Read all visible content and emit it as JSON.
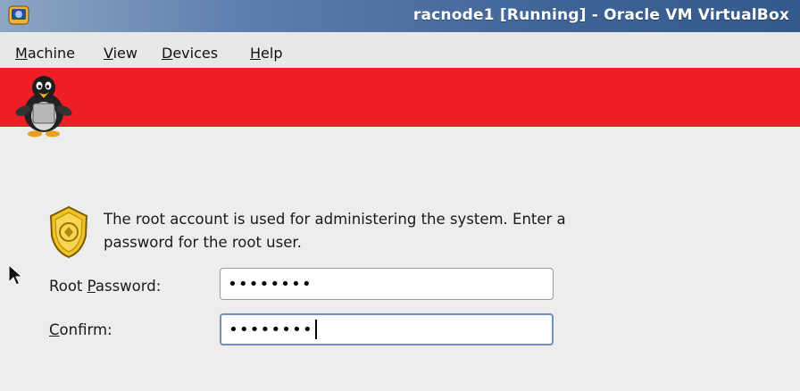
{
  "window": {
    "title": "racnode1 [Running] - Oracle VM VirtualBox",
    "icon": "virtualbox-icon"
  },
  "menu": {
    "items": [
      {
        "mnemonic": "M",
        "rest": "achine"
      },
      {
        "mnemonic": "V",
        "rest": "iew"
      },
      {
        "mnemonic": "D",
        "rest": "evices"
      },
      {
        "mnemonic": "H",
        "rest": "elp"
      }
    ]
  },
  "banner": {
    "color": "#ef1d26",
    "logo": "tux-penguin-icon"
  },
  "content": {
    "info_icon": "security-badge-icon",
    "info_text": "The root account is used for administering the system.  Enter a password for the root user.",
    "root_password": {
      "label_pre": "Root ",
      "label_mnemonic": "P",
      "label_post": "assword:",
      "value": "••••••••"
    },
    "confirm": {
      "label_pre": "",
      "label_mnemonic": "C",
      "label_post": "onfirm:",
      "value": "••••••••"
    }
  },
  "colors": {
    "titlebar": "#3e6496",
    "focus_border": "#6f8fbf",
    "background": "#ededed"
  }
}
